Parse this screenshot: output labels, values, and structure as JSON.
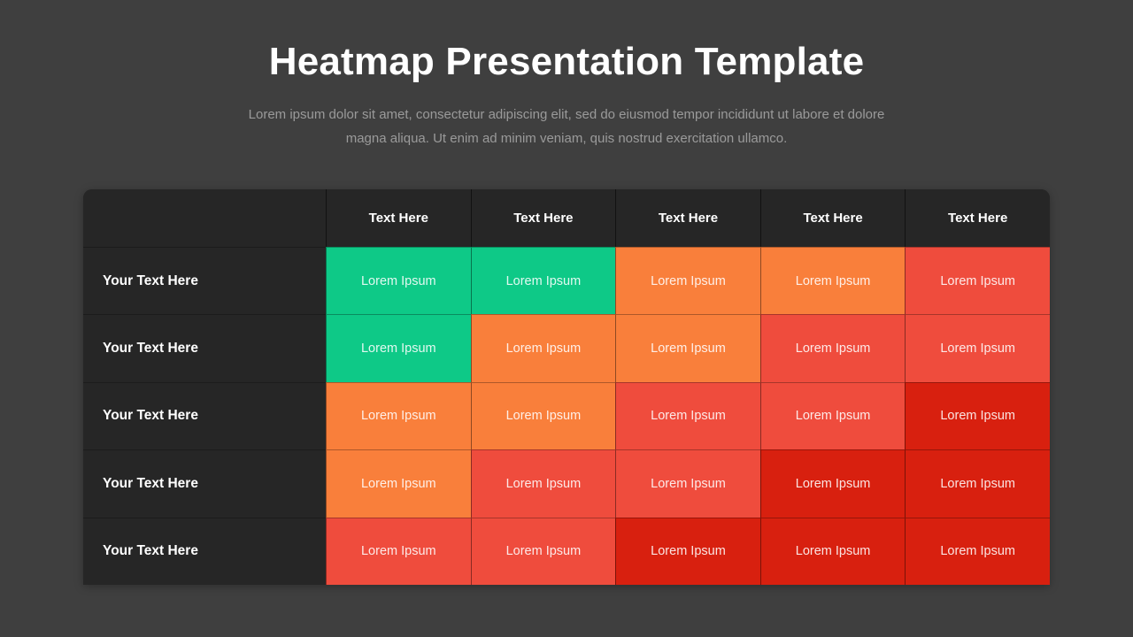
{
  "header": {
    "title": "Heatmap Presentation Template",
    "subtitle": "Lorem ipsum dolor sit amet, consectetur adipiscing elit, sed do eiusmod tempor incididunt ut labore et dolore magna aliqua. Ut enim ad minim veniam, quis nostrud exercitation ullamco."
  },
  "table": {
    "corner_label": "",
    "column_headers": [
      "Text Here",
      "Text Here",
      "Text Here",
      "Text Here",
      "Text Here"
    ],
    "row_headers": [
      "Your Text Here",
      "Your Text Here",
      "Your Text Here",
      "Your Text Here",
      "Your Text Here"
    ],
    "cell_label": "Lorem Ipsum"
  },
  "colors": {
    "background": "#3f3f3f",
    "panel": "#262626",
    "title_text": "#ffffff",
    "subtitle_text": "#9a9a9a",
    "green": "#0ec987",
    "orange": "#f97f3b",
    "red": "#ef4c3d",
    "dark_red": "#d8200f"
  },
  "chart_data": {
    "type": "heatmap",
    "title": "Heatmap Presentation Template",
    "xlabel": "",
    "ylabel": "",
    "x_tick_labels": [
      "Text Here",
      "Text Here",
      "Text Here",
      "Text Here",
      "Text Here"
    ],
    "y_tick_labels": [
      "Your Text Here",
      "Your Text Here",
      "Your Text Here",
      "Your Text Here",
      "Your Text Here"
    ],
    "cell_text": "Lorem Ipsum",
    "grid": true,
    "legend": "none",
    "scale_levels": [
      "green",
      "orange",
      "red",
      "dark_red"
    ],
    "level_colors": {
      "green": "#0ec987",
      "orange": "#f97f3b",
      "red": "#ef4c3d",
      "dark_red": "#d8200f"
    },
    "level_values": {
      "green": 1,
      "orange": 2,
      "red": 3,
      "dark_red": 4
    },
    "values": [
      [
        1,
        1,
        2,
        2,
        3
      ],
      [
        1,
        2,
        2,
        3,
        3
      ],
      [
        2,
        2,
        3,
        3,
        4
      ],
      [
        2,
        3,
        3,
        4,
        4
      ],
      [
        3,
        3,
        4,
        4,
        4
      ]
    ],
    "rows": [
      {
        "label": "Your Text Here",
        "cells": [
          {
            "text": "Lorem Ipsum",
            "level": "green",
            "color": "#0ec987"
          },
          {
            "text": "Lorem Ipsum",
            "level": "green",
            "color": "#0ec987"
          },
          {
            "text": "Lorem Ipsum",
            "level": "orange",
            "color": "#f97f3b"
          },
          {
            "text": "Lorem Ipsum",
            "level": "orange",
            "color": "#f97f3b"
          },
          {
            "text": "Lorem Ipsum",
            "level": "red",
            "color": "#ef4c3d"
          }
        ]
      },
      {
        "label": "Your Text Here",
        "cells": [
          {
            "text": "Lorem Ipsum",
            "level": "green",
            "color": "#0ec987"
          },
          {
            "text": "Lorem Ipsum",
            "level": "orange",
            "color": "#f97f3b"
          },
          {
            "text": "Lorem Ipsum",
            "level": "orange",
            "color": "#f97f3b"
          },
          {
            "text": "Lorem Ipsum",
            "level": "red",
            "color": "#ef4c3d"
          },
          {
            "text": "Lorem Ipsum",
            "level": "red",
            "color": "#ef4c3d"
          }
        ]
      },
      {
        "label": "Your Text Here",
        "cells": [
          {
            "text": "Lorem Ipsum",
            "level": "orange",
            "color": "#f97f3b"
          },
          {
            "text": "Lorem Ipsum",
            "level": "orange",
            "color": "#f97f3b"
          },
          {
            "text": "Lorem Ipsum",
            "level": "red",
            "color": "#ef4c3d"
          },
          {
            "text": "Lorem Ipsum",
            "level": "red",
            "color": "#ef4c3d"
          },
          {
            "text": "Lorem Ipsum",
            "level": "dark_red",
            "color": "#d8200f"
          }
        ]
      },
      {
        "label": "Your Text Here",
        "cells": [
          {
            "text": "Lorem Ipsum",
            "level": "orange",
            "color": "#f97f3b"
          },
          {
            "text": "Lorem Ipsum",
            "level": "red",
            "color": "#ef4c3d"
          },
          {
            "text": "Lorem Ipsum",
            "level": "red",
            "color": "#ef4c3d"
          },
          {
            "text": "Lorem Ipsum",
            "level": "dark_red",
            "color": "#d8200f"
          },
          {
            "text": "Lorem Ipsum",
            "level": "dark_red",
            "color": "#d8200f"
          }
        ]
      },
      {
        "label": "Your Text Here",
        "cells": [
          {
            "text": "Lorem Ipsum",
            "level": "red",
            "color": "#ef4c3d"
          },
          {
            "text": "Lorem Ipsum",
            "level": "red",
            "color": "#ef4c3d"
          },
          {
            "text": "Lorem Ipsum",
            "level": "dark_red",
            "color": "#d8200f"
          },
          {
            "text": "Lorem Ipsum",
            "level": "dark_red",
            "color": "#d8200f"
          },
          {
            "text": "Lorem Ipsum",
            "level": "dark_red",
            "color": "#d8200f"
          }
        ]
      }
    ]
  }
}
